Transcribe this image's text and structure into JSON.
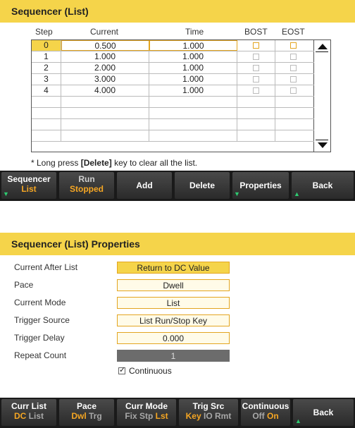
{
  "list_screen": {
    "title": "Sequencer (List)",
    "columns": [
      "Step",
      "Current",
      "Time",
      "BOST",
      "EOST"
    ],
    "rows": [
      {
        "step": "0",
        "current": "0.500",
        "time": "1.000"
      },
      {
        "step": "1",
        "current": "1.000",
        "time": "1.000"
      },
      {
        "step": "2",
        "current": "2.000",
        "time": "1.000"
      },
      {
        "step": "3",
        "current": "3.000",
        "time": "1.000"
      },
      {
        "step": "4",
        "current": "4.000",
        "time": "1.000"
      }
    ],
    "note_prefix": "* Long press ",
    "note_key": "[Delete]",
    "note_suffix": " key to clear all the list.",
    "softkeys": {
      "sequencer": {
        "line1": "Sequencer",
        "line2": "List"
      },
      "run": {
        "line1": "Run",
        "line2": "Stopped"
      },
      "add": "Add",
      "delete": "Delete",
      "properties": "Properties",
      "back": "Back"
    }
  },
  "props_screen": {
    "title": "Sequencer (List) Properties",
    "fields": [
      {
        "label": "Current After List",
        "value": "Return to DC Value"
      },
      {
        "label": "Pace",
        "value": "Dwell"
      },
      {
        "label": "Current Mode",
        "value": "List"
      },
      {
        "label": "Trigger Source",
        "value": "List Run/Stop Key"
      },
      {
        "label": "Trigger Delay",
        "value": "0.000"
      },
      {
        "label": "Repeat Count",
        "value": "1"
      }
    ],
    "continuous_label": "Continuous",
    "softkeys": {
      "curr_list": {
        "line1": "Curr List",
        "opt_a": "DC",
        "opt_b": "List"
      },
      "pace": {
        "line1": "Pace",
        "opt_a": "Dwl",
        "opt_b": "Trg"
      },
      "curr_mode": {
        "line1": "Curr Mode",
        "opt_a": "Fix Stp",
        "opt_b": "Lst"
      },
      "trig_src": {
        "line1": "Trig Src",
        "opt_a": "Key",
        "opt_b": "IO Rmt"
      },
      "continuous": {
        "line1": "Continuous",
        "opt_a": "Off",
        "opt_b": "On"
      },
      "back": "Back"
    }
  },
  "colors": {
    "accent_yellow": "#f5d44a",
    "softkey_orange": "#f5a623",
    "softkey_bg": "#2a2a2a",
    "arrow_green": "#2ecc71"
  }
}
